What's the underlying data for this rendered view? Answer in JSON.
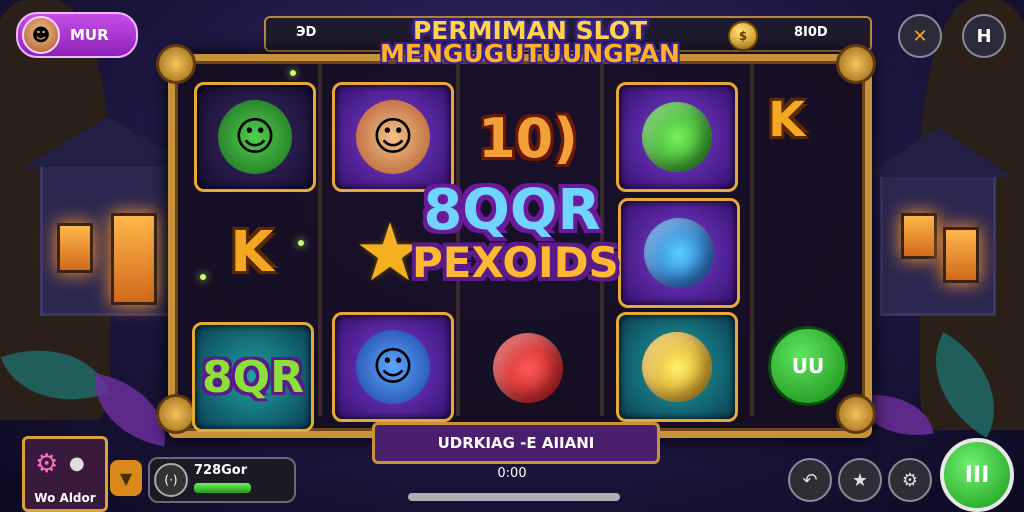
{
  "player": {
    "name": "MUR",
    "avatar_icon": "player-avatar-icon"
  },
  "topbar": {
    "left_value": "ЭD",
    "right_value": "8I0D",
    "coin_icon": "coin-icon"
  },
  "title": {
    "line1": "PERMIMAN SLOT",
    "line2": "MENGUGUTUUNGPAN"
  },
  "buttons": {
    "close_label": "✕",
    "help_label": "H"
  },
  "reels": {
    "col1": [
      "green-helmet-character",
      "K",
      "8QR"
    ],
    "col2": [
      "red-hair-character",
      "gold-star",
      "blue-helmet-character"
    ],
    "col3": [
      "10)",
      "",
      "red-candy"
    ],
    "col4": [
      "green-candy",
      "blue-candy",
      "yellow-candy"
    ]
  },
  "labels": {
    "k": "K",
    "num": "10)",
    "code": "8QR"
  },
  "overlay": {
    "line1": "8QQR",
    "line2": "PEXOIDS"
  },
  "side": {
    "k": "K",
    "button_label": "UU"
  },
  "win": {
    "banner": "UDRKIAG -E AIIANI",
    "amount": "0:00"
  },
  "auto": {
    "label": "Wo Aldor"
  },
  "bet": {
    "value": "728Gor",
    "icon_label": "(·)",
    "level": 0.62
  },
  "controls": {
    "back_icon": "back-arrow-icon",
    "star_icon": "star-icon",
    "gear_icon": "gear-icon",
    "spin_label": "III"
  },
  "colors": {
    "frame": "#c8923a",
    "accent_purple": "#8a22b8",
    "spin_green": "#2fbf2f"
  }
}
